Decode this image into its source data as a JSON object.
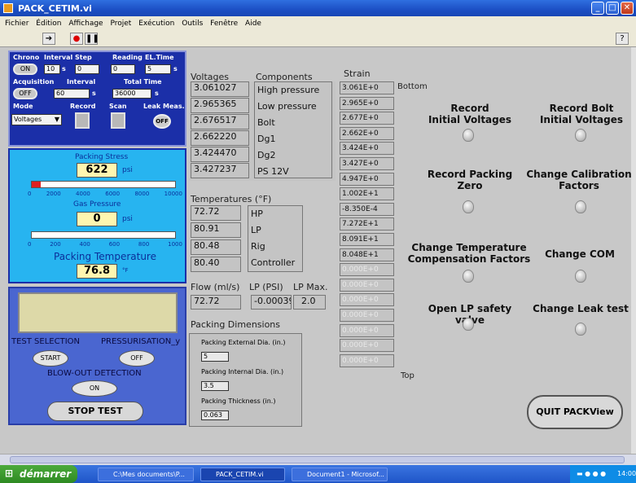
{
  "window": {
    "title": "PACK_CETIM.vi"
  },
  "menu": [
    "Fichier",
    "Édition",
    "Affichage",
    "Projet",
    "Exécution",
    "Outils",
    "Fenêtre",
    "Aide"
  ],
  "control_box": {
    "chrono_label": "Chrono",
    "interval_step_label": "Interval",
    "step_label": "Step",
    "reading_label": "Reading",
    "el_time_label": "EL.Time",
    "chrono_btn": "ON",
    "interval_val": "10",
    "interval_unit": "s",
    "step_val": "0",
    "reading_val": "0",
    "el_time_val": "5",
    "el_time_unit": "s",
    "acquisition_label": "Acquisition",
    "acq_interval_label": "Interval",
    "total_time_label": "Total Time",
    "acquisition_btn": "OFF",
    "acq_interval_val": "60",
    "acq_interval_unit": "s",
    "total_time_val": "36000",
    "total_time_unit": "s",
    "mode_label": "Mode",
    "record_label": "Record",
    "scan_label": "Scan",
    "leak_label": "Leak Meas.",
    "mode_val": "Voltages",
    "leak_btn": "OFF"
  },
  "gauges": {
    "packing_stress_label": "Packing Stress",
    "packing_stress_val": "622",
    "packing_stress_unit": "psi",
    "packing_stress_fill": 0.06,
    "stress_ticks": [
      "0",
      "2000",
      "4000",
      "6000",
      "8000",
      "10000"
    ],
    "gas_pressure_label": "Gas Pressure",
    "gas_pressure_val": "0",
    "gas_pressure_unit": "psi",
    "gas_pressure_fill": 0.0,
    "gas_ticks": [
      "0",
      "200",
      "400",
      "600",
      "800",
      "1000"
    ],
    "packing_temp_label": "Packing Temperature",
    "packing_temp_val": "76.8",
    "packing_temp_unit": "°F"
  },
  "test": {
    "test_selection_label": "TEST SELECTION",
    "pressurisation_label": "PRESSURISATION_y",
    "start_btn": "START",
    "off_btn": "OFF",
    "blowout_label": "BLOW-OUT DETECTION",
    "on_btn": "ON",
    "stop_btn": "STOP TEST"
  },
  "voltages": {
    "header": "Voltages",
    "values": [
      "3.061027",
      "2.965365",
      "2.676517",
      "2.662220",
      "3.424470",
      "3.427237"
    ]
  },
  "components": {
    "header": "Components",
    "items": [
      "High pressure",
      "Low pressure",
      "Bolt",
      "Dg1",
      "Dg2",
      "PS 12V"
    ]
  },
  "temperatures": {
    "header": "Temperatures (°F)",
    "values": [
      "72.72",
      "80.91",
      "80.48",
      "80.40"
    ],
    "labels": [
      "HP",
      "LP",
      "Rig",
      "Controller"
    ]
  },
  "flow": {
    "flow_label": "Flow (ml/s)",
    "lp_label": "LP (PSI)",
    "lpmax_label": "LP Max.",
    "flow_val": "72.72",
    "lp_val": "-0.00039",
    "lpmax_val": "2.0"
  },
  "dims": {
    "header": "Packing Dimensions",
    "ext_label": "Packing External Dia. (in.)",
    "ext_val": "5",
    "int_label": "Packing Internal Dia. (in.)",
    "int_val": "3.5",
    "thick_label": "Packing Thickness (in.)",
    "thick_val": "0.063"
  },
  "strain": {
    "header": "Strain",
    "bottom_label": "Bottom",
    "top_label": "Top",
    "values": [
      "3.061E+0",
      "2.965E+0",
      "2.677E+0",
      "2.662E+0",
      "3.424E+0",
      "3.427E+0",
      "4.947E+0",
      "1.002E+1",
      "-8.350E-4",
      "7.272E+1",
      "8.091E+1",
      "8.048E+1",
      "0.000E+0",
      "0.000E+0",
      "0.000E+0",
      "0.000E+0",
      "0.000E+0",
      "0.000E+0",
      "0.000E+0"
    ]
  },
  "actions": {
    "record_initial": "Record\nInitial Voltages",
    "record_bolt": "Record Bolt\nInitial Voltages",
    "record_zero": "Record Packing\nZero",
    "change_calib": "Change Calibration\nFactors",
    "change_temp": "Change Temperature\nCompensation Factors",
    "change_com": "Change COM",
    "open_lp": "Open LP safety valve",
    "change_leak": "Change Leak test",
    "quit": "QUIT PACKView"
  },
  "taskbar": {
    "start": "démarrer",
    "tasks": [
      "C:\\Mes documents\\P...",
      "PACK_CETIM.vi",
      "Document1 - Microsof..."
    ],
    "clock": "14:00"
  }
}
